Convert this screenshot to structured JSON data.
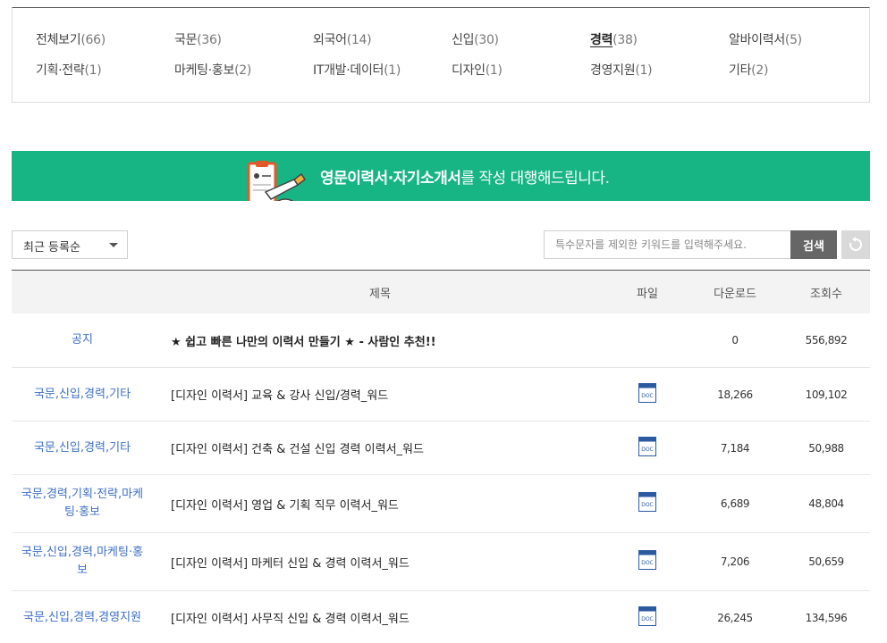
{
  "categories": [
    {
      "name": "전체보기",
      "count": "(66)",
      "active": false
    },
    {
      "name": "국문",
      "count": "(36)",
      "active": false
    },
    {
      "name": "외국어",
      "count": "(14)",
      "active": false
    },
    {
      "name": "신입",
      "count": "(30)",
      "active": false
    },
    {
      "name": "경력",
      "count": "(38)",
      "active": true
    },
    {
      "name": "알바이력서",
      "count": "(5)",
      "active": false
    },
    {
      "name": "기획·전략",
      "count": "(1)",
      "active": false
    },
    {
      "name": "마케팅·홍보",
      "count": "(2)",
      "active": false
    },
    {
      "name": "IT개발·데이터",
      "count": "(1)",
      "active": false
    },
    {
      "name": "디자인",
      "count": "(1)",
      "active": false
    },
    {
      "name": "경영지원",
      "count": "(1)",
      "active": false
    },
    {
      "name": "기타",
      "count": "(2)",
      "active": false
    }
  ],
  "banner": {
    "bold": "영문이력서·자기소개서",
    "rest": "를 작성 대행해드립니다.",
    "bg_color": "#18b584"
  },
  "toolbar": {
    "sort_label": "최근 등록순",
    "search_placeholder": "특수문자를 제외한 키워드를 입력해주세요.",
    "search_button": "검색",
    "reset_icon": "refresh-icon"
  },
  "table": {
    "headers": {
      "title": "제목",
      "file": "파일",
      "downloads": "다운로드",
      "views": "조회수"
    },
    "rows": [
      {
        "category": "공지",
        "title": "★ 쉽고 빠른 나만의 이력서 만들기 ★ - 사람인 추천!!",
        "file": false,
        "downloads": "0",
        "views": "556,892",
        "notice": true
      },
      {
        "category": "국문,신입,경력,기타",
        "title": "[디자인 이력서] 교육 & 강사 신입/경력_워드",
        "file": true,
        "downloads": "18,266",
        "views": "109,102"
      },
      {
        "category": "국문,신입,경력,기타",
        "title": "[디자인 이력서] 건축 & 건설 신입 경력 이력서_워드",
        "file": true,
        "downloads": "7,184",
        "views": "50,988"
      },
      {
        "category": "국문,경력,기획·전략,마케팅·홍보",
        "title": "[디자인 이력서] 영업 & 기획 직무 이력서_워드",
        "file": true,
        "downloads": "6,689",
        "views": "48,804"
      },
      {
        "category": "국문,신입,경력,마케팅·홍보",
        "title": "[디자인 이력서] 마케터 신입 & 경력 이력서_워드",
        "file": true,
        "downloads": "7,206",
        "views": "50,659"
      },
      {
        "category": "국문,신입,경력,경영지원",
        "title": "[디자인 이력서] 사무직 신입 & 경력 이력서_워드",
        "file": true,
        "downloads": "26,245",
        "views": "134,596"
      }
    ]
  },
  "colors": {
    "category_link": "#3d6fc8",
    "doc_icon": "#2c5aa0"
  }
}
